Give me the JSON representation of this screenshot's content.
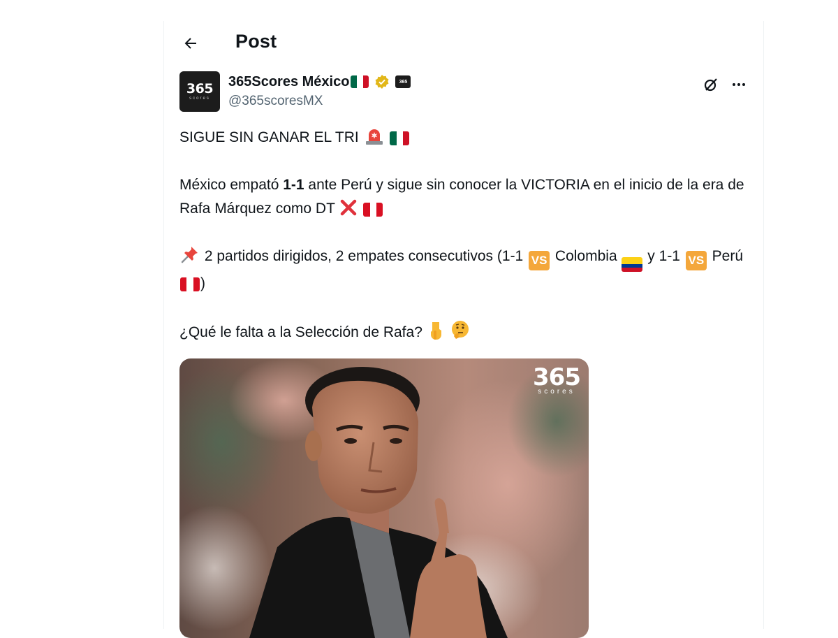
{
  "header": {
    "title": "Post"
  },
  "author": {
    "avatar_text": "365",
    "avatar_subtext": "scores",
    "display_name": "365Scores México",
    "handle": "@365scoresMX",
    "verified": true,
    "affiliate_badge_text": "365"
  },
  "tweet": {
    "line1": "SIGUE SIN GANAR EL TRI",
    "para2_a": "México empató ",
    "para2_score": "1-1",
    "para2_b": " ante Perú y sigue sin conocer la VICTORIA en el inicio de la era de Rafa Márquez como DT",
    "para3_a": " 2 partidos dirigidos, 2 empates consecutivos (1-1 ",
    "vs_label": "VS",
    "para3_b": " Colombia ",
    "para3_c": " y 1-1 ",
    "para3_d": " Perú ",
    "para3_e": ")",
    "para4": "¿Qué le falta a la Selección de Rafa?"
  },
  "media": {
    "logo_main": "365",
    "logo_sub": "scores"
  },
  "colors": {
    "accent": "#1d9bf0",
    "text": "#0f1419",
    "secondary": "#536471",
    "vs_badge": "#f4a73b",
    "verified_gold": "#e2b719"
  },
  "icons": {
    "back": "arrow-left-icon",
    "grok": "grok-icon",
    "more": "more-horizontal-icon",
    "verified": "verified-badge-icon"
  }
}
